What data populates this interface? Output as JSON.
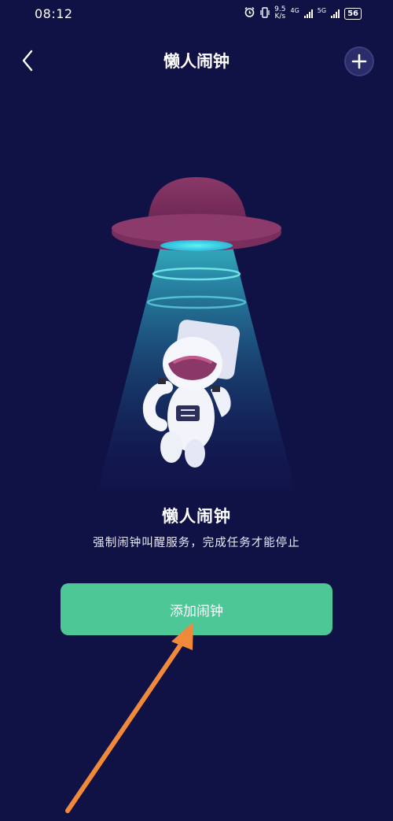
{
  "status_bar": {
    "time": "08:12",
    "net_speed_value": "9.5",
    "net_speed_unit": "K/s",
    "signal_1_label": "4G",
    "signal_2_label": "5G",
    "battery": "56"
  },
  "header": {
    "title": "懒人闹钟"
  },
  "main": {
    "title": "懒人闹钟",
    "description": "强制闹钟叫醒服务，完成任务才能停止",
    "add_button_label": "添加闹钟"
  },
  "colors": {
    "background": "#101246",
    "accent_green": "#4dc796",
    "arrow_orange": "#f08a3a",
    "ufo_purple": "#7a2e5e",
    "beam_cyan": "#3fe0e8"
  }
}
